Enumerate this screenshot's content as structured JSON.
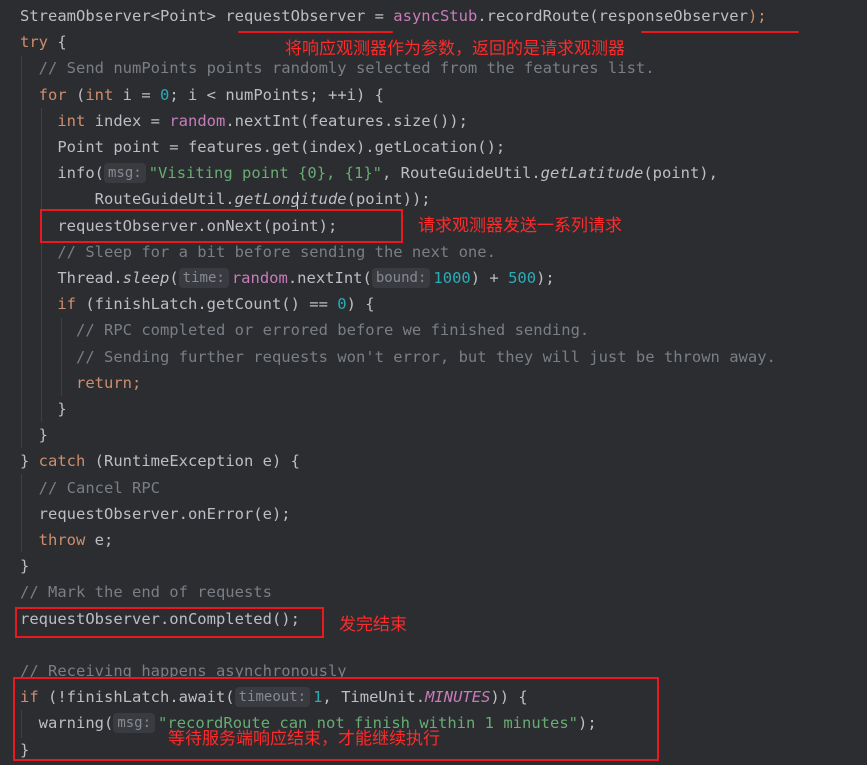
{
  "code_lines": [
    [
      {
        "t": "StreamObserver<Point> ",
        "c": "plain"
      },
      {
        "t": "requestObserver",
        "c": "plain"
      },
      {
        "t": " = ",
        "c": "plain"
      },
      {
        "t": "asyncStub",
        "c": "field"
      },
      {
        "t": ".recordRoute(",
        "c": "plain"
      },
      {
        "t": "responseObserver",
        "c": "plain"
      },
      {
        "t": ");",
        "c": "kw"
      }
    ],
    [
      {
        "t": "try",
        "c": "kw"
      },
      {
        "t": " {",
        "c": "plain"
      }
    ],
    [
      {
        "t": "  // Send numPoints points randomly selected from the features list.",
        "c": "comment"
      }
    ],
    [
      {
        "t": "  ",
        "c": "plain"
      },
      {
        "t": "for",
        "c": "kw"
      },
      {
        "t": " (",
        "c": "plain"
      },
      {
        "t": "int",
        "c": "kw"
      },
      {
        "t": " i = ",
        "c": "plain"
      },
      {
        "t": "0",
        "c": "num"
      },
      {
        "t": "; i < numPoints; ++i) {",
        "c": "plain"
      }
    ],
    [
      {
        "t": "    ",
        "c": "plain"
      },
      {
        "t": "int",
        "c": "kw"
      },
      {
        "t": " index = ",
        "c": "plain"
      },
      {
        "t": "random",
        "c": "field"
      },
      {
        "t": ".nextInt(features.size());",
        "c": "plain"
      }
    ],
    [
      {
        "t": "    Point point = features.get(index).getLocation();",
        "c": "plain"
      }
    ],
    [
      {
        "t": "    info(",
        "c": "plain"
      },
      {
        "h": "msg:"
      },
      {
        "t": "\"Visiting point {0}, {1}\"",
        "c": "str"
      },
      {
        "t": ", RouteGuideUtil.",
        "c": "plain"
      },
      {
        "t": "getLatitude",
        "c": "italic"
      },
      {
        "t": "(point),",
        "c": "plain"
      }
    ],
    [
      {
        "t": "        RouteGuideUtil.",
        "c": "plain"
      },
      {
        "t": "getLongitude",
        "c": "italic"
      },
      {
        "t": "(point));",
        "c": "plain"
      }
    ],
    [
      {
        "t": "    requestObserver.onNext(point);",
        "c": "plain"
      }
    ],
    [
      {
        "t": "    // Sleep for a bit before sending the next one.",
        "c": "comment"
      }
    ],
    [
      {
        "t": "    Thread.",
        "c": "plain"
      },
      {
        "t": "sleep",
        "c": "italic"
      },
      {
        "t": "(",
        "c": "plain"
      },
      {
        "h": "time:"
      },
      {
        "t": "random",
        "c": "field"
      },
      {
        "t": ".nextInt(",
        "c": "plain"
      },
      {
        "h": "bound:"
      },
      {
        "t": "1000",
        "c": "num"
      },
      {
        "t": ") + ",
        "c": "plain"
      },
      {
        "t": "500",
        "c": "num"
      },
      {
        "t": ");",
        "c": "plain"
      }
    ],
    [
      {
        "t": "    ",
        "c": "plain"
      },
      {
        "t": "if",
        "c": "kw"
      },
      {
        "t": " (finishLatch.getCount() == ",
        "c": "plain"
      },
      {
        "t": "0",
        "c": "num"
      },
      {
        "t": ") {",
        "c": "plain"
      }
    ],
    [
      {
        "t": "      // RPC completed or errored before we finished sending.",
        "c": "comment"
      }
    ],
    [
      {
        "t": "      // Sending further requests won't error, but they will just be thrown away.",
        "c": "comment"
      }
    ],
    [
      {
        "t": "      ",
        "c": "plain"
      },
      {
        "t": "return",
        "c": "kw"
      },
      {
        "t": ";",
        "c": "kw"
      }
    ],
    [
      {
        "t": "    }",
        "c": "plain"
      }
    ],
    [
      {
        "t": "  }",
        "c": "plain"
      }
    ],
    [
      {
        "t": "} ",
        "c": "plain"
      },
      {
        "t": "catch",
        "c": "kw"
      },
      {
        "t": " (RuntimeException e) {",
        "c": "plain"
      }
    ],
    [
      {
        "t": "  // Cancel RPC",
        "c": "comment"
      }
    ],
    [
      {
        "t": "  requestObserver.onError(e);",
        "c": "plain"
      }
    ],
    [
      {
        "t": "  ",
        "c": "plain"
      },
      {
        "t": "throw",
        "c": "kw"
      },
      {
        "t": " e;",
        "c": "plain"
      }
    ],
    [
      {
        "t": "}",
        "c": "plain"
      }
    ],
    [
      {
        "t": "// Mark the end of requests",
        "c": "comment"
      }
    ],
    [
      {
        "t": "requestObserver.onCompleted();",
        "c": "plain"
      }
    ],
    [
      {
        "t": "",
        "c": "plain"
      }
    ],
    [
      {
        "t": "// Receiving happens asynchronously",
        "c": "comment"
      }
    ],
    [
      {
        "t": "if",
        "c": "kw"
      },
      {
        "t": " (!finishLatch.await(",
        "c": "plain"
      },
      {
        "h": "timeout:"
      },
      {
        "t": "1",
        "c": "num"
      },
      {
        "t": ", TimeUnit.",
        "c": "plain"
      },
      {
        "t": "MINUTES",
        "c": "static"
      },
      {
        "t": ")) {",
        "c": "plain"
      }
    ],
    [
      {
        "t": "  warning(",
        "c": "plain"
      },
      {
        "h": "msg:"
      },
      {
        "t": "\"recordRoute can not finish within 1 minutes\"",
        "c": "str"
      },
      {
        "t": ");",
        "c": "plain"
      }
    ],
    [
      {
        "t": "}",
        "c": "plain"
      }
    ]
  ],
  "annotations": {
    "note_1": "将响应观测器作为参数，返回的是请求观测器",
    "note_2": "请求观测器发送一系列请求",
    "note_3": "发完结束",
    "note_4": "等待服务端响应结束，才能继续执行"
  },
  "colors": {
    "background": "#2b2d30",
    "keyword": "#cf8e6d",
    "number": "#2aacb8",
    "string": "#6aab73",
    "comment": "#7a7e85",
    "field": "#c77dbb",
    "annotation": "#ff2a2a"
  }
}
